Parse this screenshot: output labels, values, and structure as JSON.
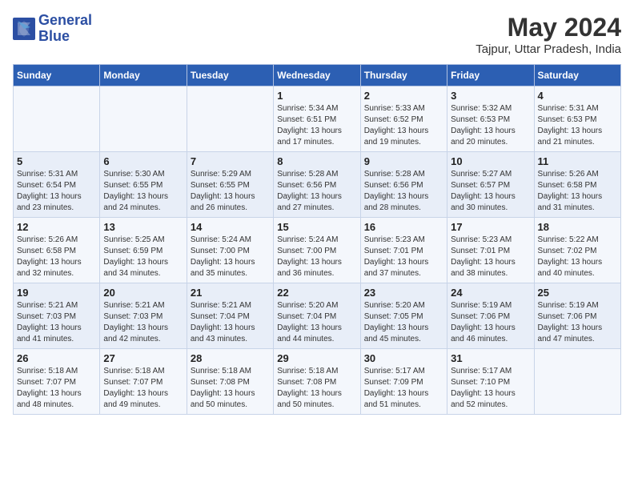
{
  "header": {
    "logo_line1": "General",
    "logo_line2": "Blue",
    "month_year": "May 2024",
    "location": "Tajpur, Uttar Pradesh, India"
  },
  "days_of_week": [
    "Sunday",
    "Monday",
    "Tuesday",
    "Wednesday",
    "Thursday",
    "Friday",
    "Saturday"
  ],
  "weeks": [
    [
      {
        "day": "",
        "info": ""
      },
      {
        "day": "",
        "info": ""
      },
      {
        "day": "",
        "info": ""
      },
      {
        "day": "1",
        "info": "Sunrise: 5:34 AM\nSunset: 6:51 PM\nDaylight: 13 hours\nand 17 minutes."
      },
      {
        "day": "2",
        "info": "Sunrise: 5:33 AM\nSunset: 6:52 PM\nDaylight: 13 hours\nand 19 minutes."
      },
      {
        "day": "3",
        "info": "Sunrise: 5:32 AM\nSunset: 6:53 PM\nDaylight: 13 hours\nand 20 minutes."
      },
      {
        "day": "4",
        "info": "Sunrise: 5:31 AM\nSunset: 6:53 PM\nDaylight: 13 hours\nand 21 minutes."
      }
    ],
    [
      {
        "day": "5",
        "info": "Sunrise: 5:31 AM\nSunset: 6:54 PM\nDaylight: 13 hours\nand 23 minutes."
      },
      {
        "day": "6",
        "info": "Sunrise: 5:30 AM\nSunset: 6:55 PM\nDaylight: 13 hours\nand 24 minutes."
      },
      {
        "day": "7",
        "info": "Sunrise: 5:29 AM\nSunset: 6:55 PM\nDaylight: 13 hours\nand 26 minutes."
      },
      {
        "day": "8",
        "info": "Sunrise: 5:28 AM\nSunset: 6:56 PM\nDaylight: 13 hours\nand 27 minutes."
      },
      {
        "day": "9",
        "info": "Sunrise: 5:28 AM\nSunset: 6:56 PM\nDaylight: 13 hours\nand 28 minutes."
      },
      {
        "day": "10",
        "info": "Sunrise: 5:27 AM\nSunset: 6:57 PM\nDaylight: 13 hours\nand 30 minutes."
      },
      {
        "day": "11",
        "info": "Sunrise: 5:26 AM\nSunset: 6:58 PM\nDaylight: 13 hours\nand 31 minutes."
      }
    ],
    [
      {
        "day": "12",
        "info": "Sunrise: 5:26 AM\nSunset: 6:58 PM\nDaylight: 13 hours\nand 32 minutes."
      },
      {
        "day": "13",
        "info": "Sunrise: 5:25 AM\nSunset: 6:59 PM\nDaylight: 13 hours\nand 34 minutes."
      },
      {
        "day": "14",
        "info": "Sunrise: 5:24 AM\nSunset: 7:00 PM\nDaylight: 13 hours\nand 35 minutes."
      },
      {
        "day": "15",
        "info": "Sunrise: 5:24 AM\nSunset: 7:00 PM\nDaylight: 13 hours\nand 36 minutes."
      },
      {
        "day": "16",
        "info": "Sunrise: 5:23 AM\nSunset: 7:01 PM\nDaylight: 13 hours\nand 37 minutes."
      },
      {
        "day": "17",
        "info": "Sunrise: 5:23 AM\nSunset: 7:01 PM\nDaylight: 13 hours\nand 38 minutes."
      },
      {
        "day": "18",
        "info": "Sunrise: 5:22 AM\nSunset: 7:02 PM\nDaylight: 13 hours\nand 40 minutes."
      }
    ],
    [
      {
        "day": "19",
        "info": "Sunrise: 5:21 AM\nSunset: 7:03 PM\nDaylight: 13 hours\nand 41 minutes."
      },
      {
        "day": "20",
        "info": "Sunrise: 5:21 AM\nSunset: 7:03 PM\nDaylight: 13 hours\nand 42 minutes."
      },
      {
        "day": "21",
        "info": "Sunrise: 5:21 AM\nSunset: 7:04 PM\nDaylight: 13 hours\nand 43 minutes."
      },
      {
        "day": "22",
        "info": "Sunrise: 5:20 AM\nSunset: 7:04 PM\nDaylight: 13 hours\nand 44 minutes."
      },
      {
        "day": "23",
        "info": "Sunrise: 5:20 AM\nSunset: 7:05 PM\nDaylight: 13 hours\nand 45 minutes."
      },
      {
        "day": "24",
        "info": "Sunrise: 5:19 AM\nSunset: 7:06 PM\nDaylight: 13 hours\nand 46 minutes."
      },
      {
        "day": "25",
        "info": "Sunrise: 5:19 AM\nSunset: 7:06 PM\nDaylight: 13 hours\nand 47 minutes."
      }
    ],
    [
      {
        "day": "26",
        "info": "Sunrise: 5:18 AM\nSunset: 7:07 PM\nDaylight: 13 hours\nand 48 minutes."
      },
      {
        "day": "27",
        "info": "Sunrise: 5:18 AM\nSunset: 7:07 PM\nDaylight: 13 hours\nand 49 minutes."
      },
      {
        "day": "28",
        "info": "Sunrise: 5:18 AM\nSunset: 7:08 PM\nDaylight: 13 hours\nand 50 minutes."
      },
      {
        "day": "29",
        "info": "Sunrise: 5:18 AM\nSunset: 7:08 PM\nDaylight: 13 hours\nand 50 minutes."
      },
      {
        "day": "30",
        "info": "Sunrise: 5:17 AM\nSunset: 7:09 PM\nDaylight: 13 hours\nand 51 minutes."
      },
      {
        "day": "31",
        "info": "Sunrise: 5:17 AM\nSunset: 7:10 PM\nDaylight: 13 hours\nand 52 minutes."
      },
      {
        "day": "",
        "info": ""
      }
    ]
  ]
}
